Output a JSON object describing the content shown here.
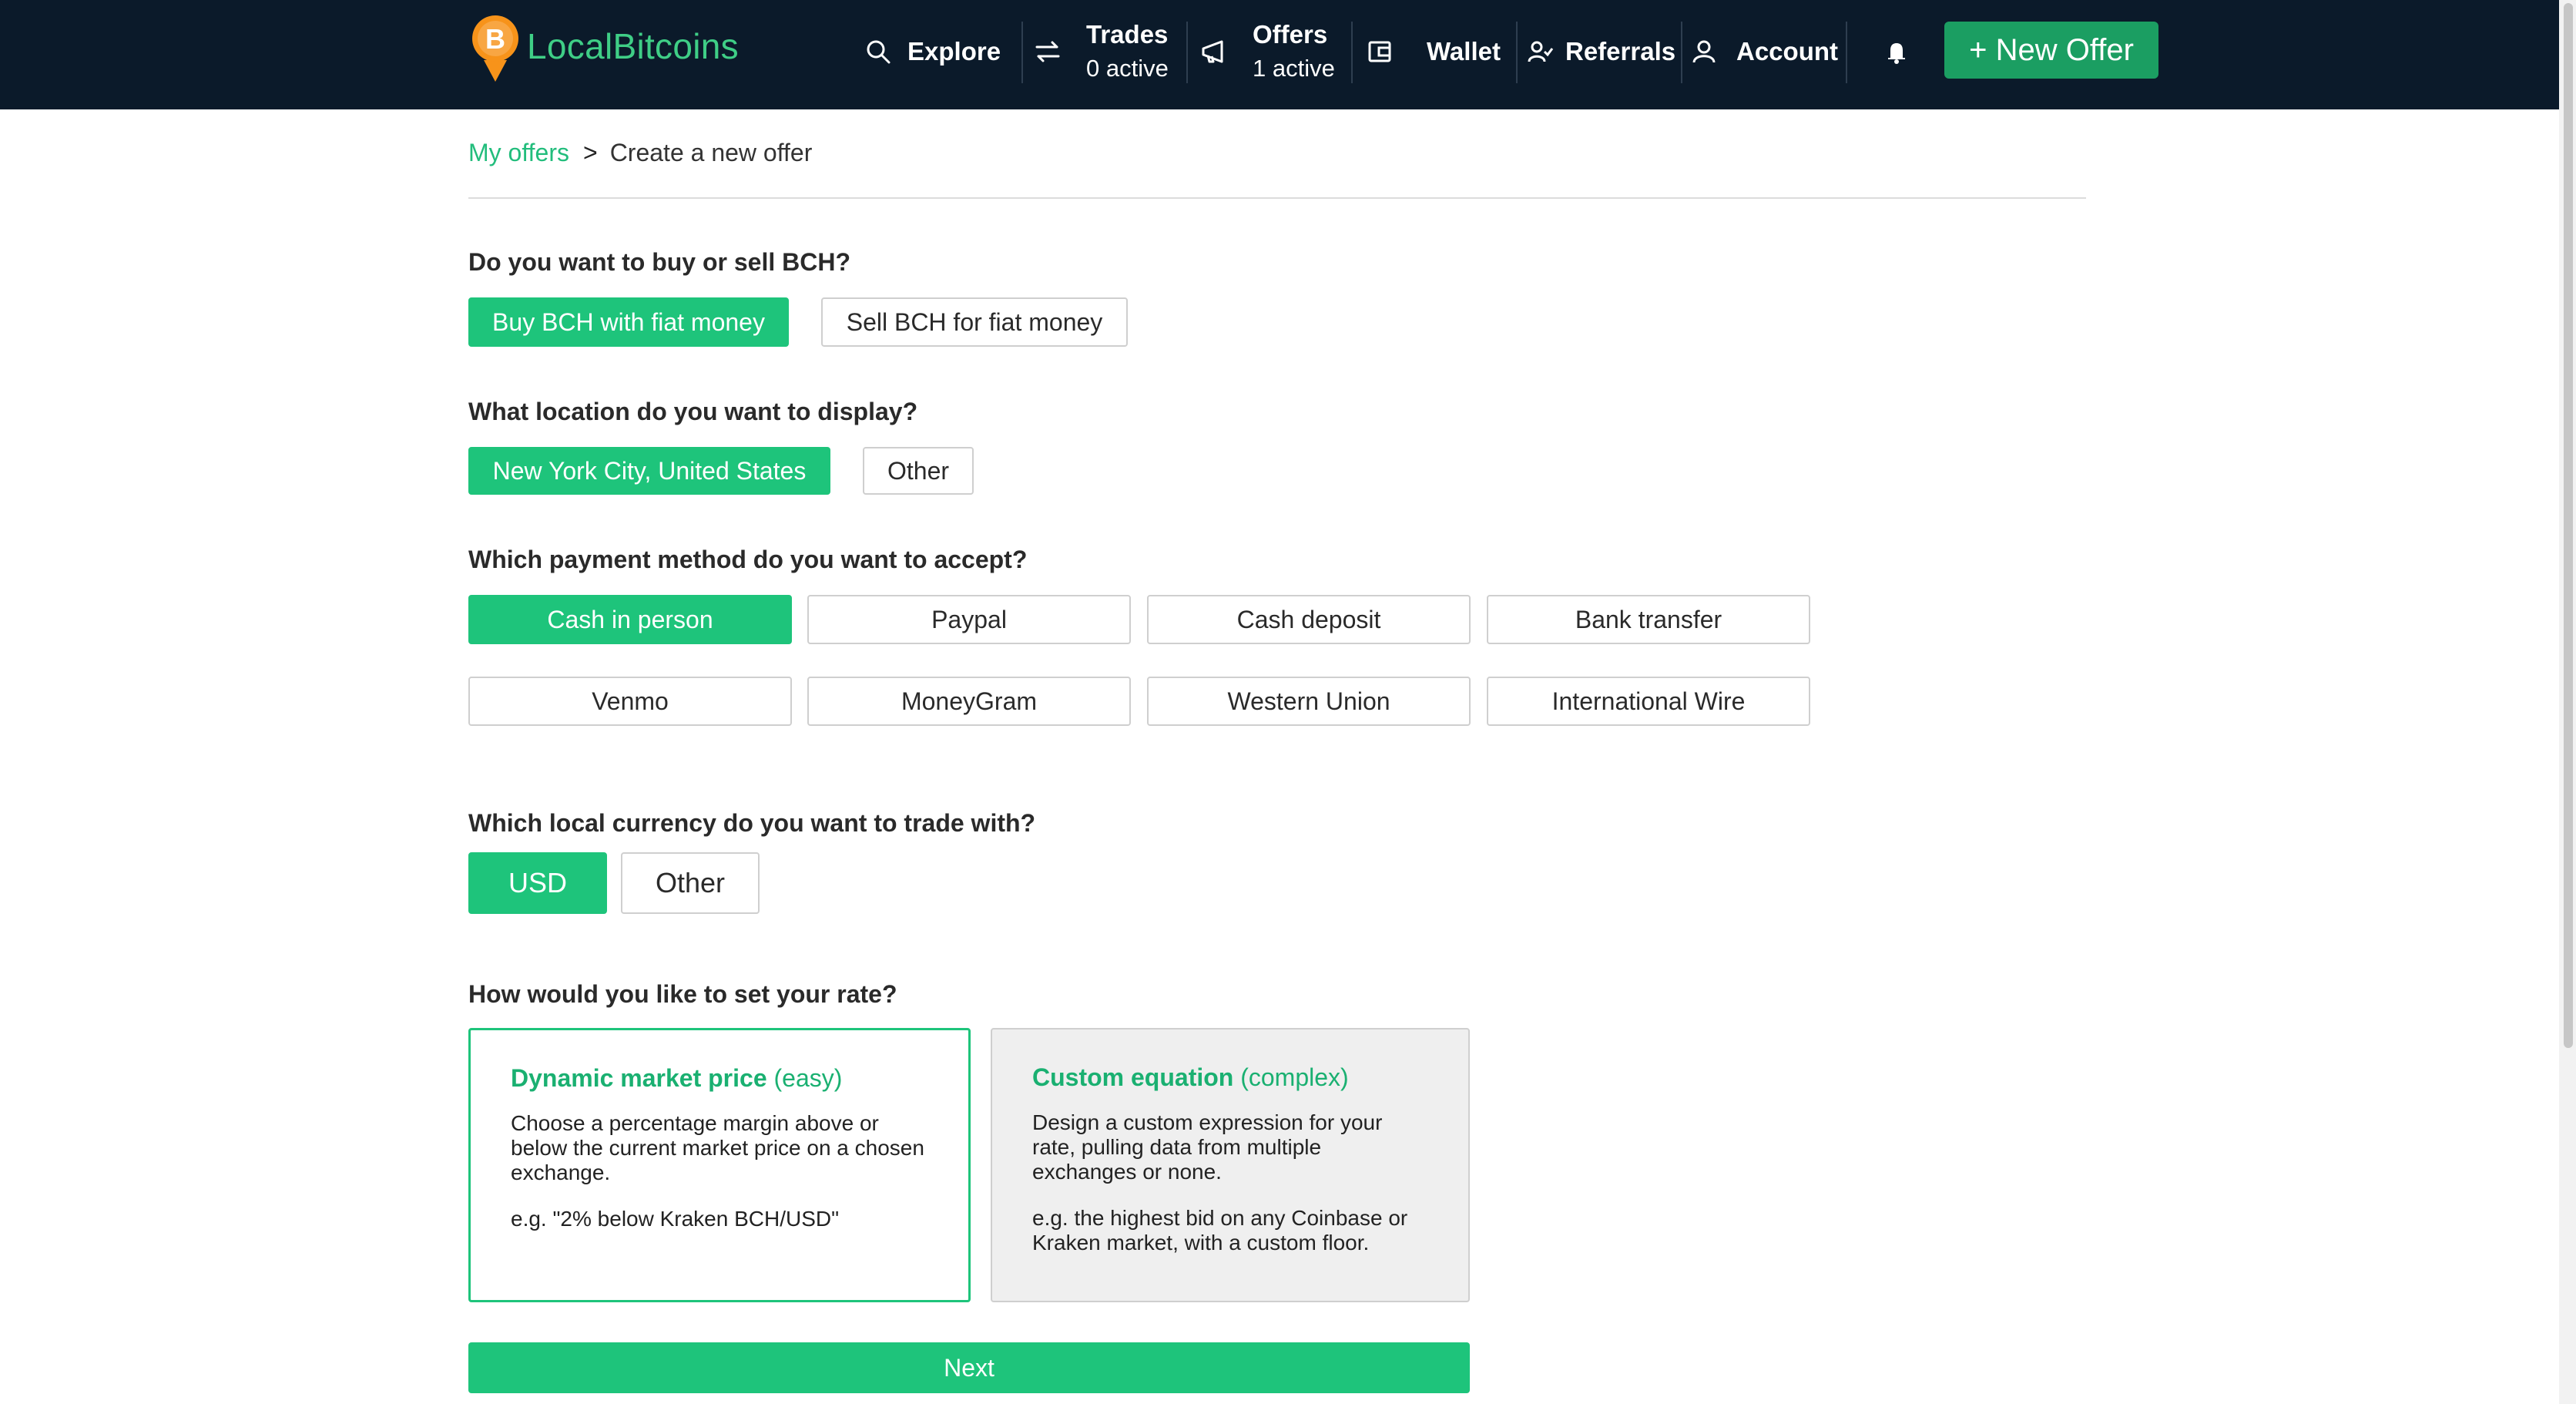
{
  "header": {
    "brand": "LocalBitcoins",
    "nav": {
      "explore": "Explore",
      "trades_label": "Trades",
      "trades_sub": "0 active",
      "offers_label": "Offers",
      "offers_sub": "1 active",
      "wallet": "Wallet",
      "referrals": "Referrals",
      "account": "Account"
    },
    "new_offer_button": "+ New Offer"
  },
  "breadcrumb": {
    "parent": "My offers",
    "separator": ">",
    "current": "Create a new offer"
  },
  "trade_type": {
    "question": "Do you want to buy or sell BCH?",
    "options": [
      "Buy BCH with fiat money",
      "Sell BCH for fiat money"
    ],
    "selected": "Buy BCH with fiat money"
  },
  "location": {
    "question": "What location do you want to display?",
    "options": [
      "New York City, United States",
      "Other"
    ],
    "selected": "New York City, United States"
  },
  "payment_method": {
    "question": "Which payment method do you want to accept?",
    "options": [
      "Cash in person",
      "Paypal",
      "Cash deposit",
      "Bank transfer",
      "Venmo",
      "MoneyGram",
      "Western Union",
      "International Wire"
    ],
    "selected": "Cash in person"
  },
  "currency": {
    "question": "Which local currency do you want to trade with?",
    "options": [
      "USD",
      "Other"
    ],
    "selected": "USD"
  },
  "rate": {
    "question": "How would you like to set your rate?",
    "dynamic": {
      "title": "Dynamic market price",
      "hint": "(easy)",
      "description": "Choose a percentage margin above or below the current market price on a chosen exchange.",
      "example": "e.g. \"2% below Kraken BCH/USD\""
    },
    "custom": {
      "title": "Custom equation",
      "hint": "(complex)",
      "description": "Design a custom expression for your rate, pulling data from multiple exchanges or none.",
      "example": "e.g. the highest bid on any Coinbase or Kraken market, with a custom floor."
    },
    "selected": "Dynamic market price"
  },
  "next_button": "Next",
  "colors": {
    "header_bg": "#0b1a2a",
    "accent_green": "#1ec47b",
    "brand_green": "#3fce86",
    "new_offer_green": "#1b9e62",
    "bitcoin_orange": "#f7931a"
  },
  "icons": [
    "bitcoin-logo-icon",
    "search-icon",
    "transfer-arrows-icon",
    "megaphone-icon",
    "wallet-icon",
    "referrals-icon",
    "account-icon",
    "bell-icon"
  ]
}
